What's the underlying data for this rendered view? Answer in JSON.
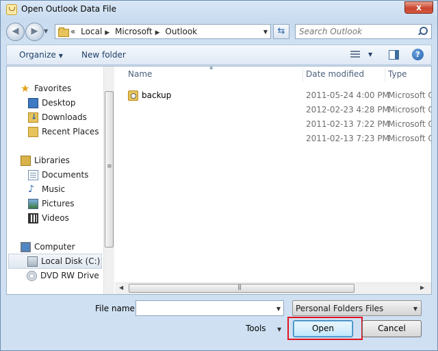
{
  "window": {
    "title": "Open Outlook Data File",
    "close_label": "x"
  },
  "navigation": {
    "breadcrumbs": [
      {
        "label": "Local"
      },
      {
        "label": "Microsoft"
      },
      {
        "label": "Outlook"
      }
    ],
    "overflow_label": "«",
    "search_placeholder": "Search Outlook"
  },
  "toolbar": {
    "organize_label": "Organize",
    "new_folder_label": "New folder",
    "help_label": "?"
  },
  "sidebar": {
    "favorites_label": "Favorites",
    "favorites": [
      {
        "label": "Desktop",
        "icon": "desktop-icon"
      },
      {
        "label": "Downloads",
        "icon": "downloads-icon"
      },
      {
        "label": "Recent Places",
        "icon": "recent-places-icon"
      }
    ],
    "libraries_label": "Libraries",
    "libraries": [
      {
        "label": "Documents",
        "icon": "documents-icon"
      },
      {
        "label": "Music",
        "icon": "music-icon"
      },
      {
        "label": "Pictures",
        "icon": "pictures-icon"
      },
      {
        "label": "Videos",
        "icon": "videos-icon"
      }
    ],
    "computer_label": "Computer",
    "drives": [
      {
        "label": "Local Disk (C:)",
        "icon": "local-disk-icon",
        "selected": true
      },
      {
        "label": "DVD RW Drive (D",
        "icon": "dvd-drive-icon"
      }
    ]
  },
  "file_list": {
    "columns": [
      "Name",
      "Date modified",
      "Type"
    ],
    "rows": [
      {
        "name": "backup",
        "date": "2011-05-24 4:00 PM",
        "type": "Microsoft Of"
      },
      {
        "name": "",
        "date": "2012-02-23 4:28 PM",
        "type": "Microsoft Of"
      },
      {
        "name": "",
        "date": "2011-02-13 7:22 PM",
        "type": "Microsoft Of"
      },
      {
        "name": "",
        "date": "2011-02-13 7:23 PM",
        "type": "Microsoft Of"
      }
    ]
  },
  "footer": {
    "file_name_label": "File name:",
    "file_name_value": "",
    "file_type_value": "Personal Folders Files",
    "tools_label": "Tools",
    "open_label": "Open",
    "cancel_label": "Cancel"
  }
}
